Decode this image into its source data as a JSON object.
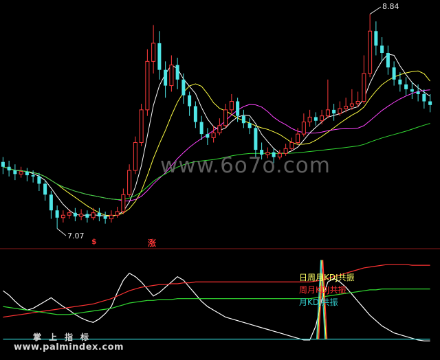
{
  "chart_data": [
    {
      "type": "candlestick",
      "panel": "price",
      "annotations": {
        "high": "8.84",
        "low": "7.07",
        "signal_1": "$",
        "signal_2": "涨"
      },
      "colors": {
        "up": "#ff3b3b",
        "down": "#4fe6e6",
        "ma5": "#ffffff",
        "ma10": "#ffff44",
        "ma20": "#ff44ff",
        "ma60": "#33dd33"
      },
      "candles": [
        [
          7.62,
          7.58,
          7.66,
          7.52
        ],
        [
          7.58,
          7.55,
          7.63,
          7.5
        ],
        [
          7.55,
          7.52,
          7.6,
          7.47
        ],
        [
          7.52,
          7.54,
          7.58,
          7.49
        ],
        [
          7.54,
          7.51,
          7.57,
          7.46
        ],
        [
          7.51,
          7.5,
          7.55,
          7.45
        ],
        [
          7.5,
          7.44,
          7.53,
          7.38
        ],
        [
          7.44,
          7.35,
          7.47,
          7.3
        ],
        [
          7.35,
          7.22,
          7.38,
          7.15
        ],
        [
          7.22,
          7.16,
          7.26,
          7.07
        ],
        [
          7.16,
          7.18,
          7.22,
          7.12
        ],
        [
          7.18,
          7.2,
          7.23,
          7.15
        ],
        [
          7.2,
          7.17,
          7.24,
          7.13
        ],
        [
          7.17,
          7.19,
          7.23,
          7.14
        ],
        [
          7.19,
          7.16,
          7.22,
          7.12
        ],
        [
          7.16,
          7.2,
          7.24,
          7.14
        ],
        [
          7.2,
          7.17,
          7.24,
          7.13
        ],
        [
          7.17,
          7.15,
          7.21,
          7.11
        ],
        [
          7.15,
          7.18,
          7.22,
          7.12
        ],
        [
          7.18,
          7.21,
          7.25,
          7.16
        ],
        [
          7.21,
          7.35,
          7.4,
          7.19
        ],
        [
          7.35,
          7.55,
          7.6,
          7.33
        ],
        [
          7.55,
          7.78,
          7.83,
          7.52
        ],
        [
          7.78,
          8.05,
          8.1,
          7.75
        ],
        [
          8.05,
          8.45,
          8.55,
          8.0
        ],
        [
          8.45,
          8.6,
          8.75,
          8.35
        ],
        [
          8.6,
          8.38,
          8.7,
          8.3
        ],
        [
          8.38,
          8.25,
          8.45,
          8.15
        ],
        [
          8.25,
          8.42,
          8.5,
          8.2
        ],
        [
          8.42,
          8.3,
          8.48,
          8.22
        ],
        [
          8.3,
          8.17,
          8.35,
          8.1
        ],
        [
          8.17,
          8.08,
          8.2,
          8.0
        ],
        [
          8.08,
          7.95,
          8.12,
          7.9
        ],
        [
          7.95,
          7.85,
          8.0,
          7.8
        ],
        [
          7.85,
          7.82,
          7.9,
          7.76
        ],
        [
          7.82,
          7.86,
          7.92,
          7.78
        ],
        [
          7.86,
          7.92,
          7.98,
          7.84
        ],
        [
          7.92,
          8.05,
          8.1,
          7.9
        ],
        [
          8.05,
          8.12,
          8.18,
          8.02
        ],
        [
          8.12,
          8.0,
          8.15,
          7.95
        ],
        [
          8.0,
          7.94,
          8.05,
          7.9
        ],
        [
          7.94,
          7.9,
          7.98,
          7.85
        ],
        [
          7.9,
          7.72,
          7.92,
          7.66
        ],
        [
          7.72,
          7.68,
          7.78,
          7.64
        ],
        [
          7.68,
          7.7,
          7.74,
          7.65
        ],
        [
          7.7,
          7.66,
          7.73,
          7.61
        ],
        [
          7.66,
          7.69,
          7.72,
          7.64
        ],
        [
          7.69,
          7.73,
          7.77,
          7.67
        ],
        [
          7.73,
          7.78,
          7.82,
          7.71
        ],
        [
          7.78,
          7.85,
          7.9,
          7.76
        ],
        [
          7.85,
          7.95,
          8.02,
          7.83
        ],
        [
          7.95,
          7.99,
          8.05,
          7.91
        ],
        [
          7.99,
          7.96,
          8.03,
          7.92
        ],
        [
          7.96,
          8.0,
          8.05,
          7.93
        ],
        [
          8.0,
          8.05,
          8.3,
          7.98
        ],
        [
          8.05,
          8.02,
          8.1,
          7.96
        ],
        [
          8.02,
          8.06,
          8.12,
          8.0
        ],
        [
          8.06,
          8.08,
          8.15,
          8.03
        ],
        [
          8.08,
          8.1,
          8.22,
          8.05
        ],
        [
          8.1,
          8.12,
          8.2,
          8.07
        ],
        [
          8.12,
          8.35,
          8.5,
          8.1
        ],
        [
          8.35,
          8.7,
          8.84,
          8.32
        ],
        [
          8.7,
          8.58,
          8.78,
          8.5
        ],
        [
          8.58,
          8.52,
          8.65,
          8.45
        ],
        [
          8.52,
          8.4,
          8.58,
          8.34
        ],
        [
          8.4,
          8.3,
          8.45,
          8.25
        ],
        [
          8.3,
          8.26,
          8.36,
          8.2
        ],
        [
          8.26,
          8.22,
          8.32,
          8.17
        ],
        [
          8.22,
          8.2,
          8.28,
          8.14
        ],
        [
          8.2,
          8.18,
          8.26,
          8.12
        ],
        [
          8.18,
          8.12,
          8.22,
          8.06
        ],
        [
          8.12,
          8.09,
          8.18,
          8.03
        ]
      ]
    },
    {
      "type": "line",
      "panel": "indicator",
      "series": [
        {
          "color": "#ffffff",
          "values": [
            60,
            55,
            48,
            42,
            38,
            40,
            44,
            48,
            52,
            47,
            42,
            38,
            33,
            29,
            26,
            24,
            28,
            34,
            42,
            58,
            72,
            80,
            76,
            70,
            62,
            54,
            58,
            64,
            70,
            76,
            72,
            64,
            56,
            48,
            42,
            38,
            34,
            30,
            28,
            26,
            24,
            22,
            20,
            18,
            16,
            14,
            12,
            10,
            8,
            6,
            4,
            4,
            20,
            50,
            70,
            74,
            70,
            64,
            56,
            48,
            40,
            32,
            26,
            20,
            16,
            12,
            10,
            8,
            6,
            4,
            3,
            3
          ]
        },
        {
          "color": "#ff3333",
          "values": [
            30,
            31,
            32,
            33,
            34,
            35,
            36,
            37,
            38,
            39,
            40,
            41,
            42,
            43,
            44,
            45,
            47,
            49,
            51,
            54,
            57,
            60,
            62,
            64,
            65,
            66,
            67,
            67,
            68,
            68,
            69,
            69,
            70,
            70,
            70,
            70,
            70,
            70,
            70,
            70,
            70,
            70,
            70,
            70,
            70,
            70,
            70,
            70,
            70,
            70,
            70,
            70,
            71,
            72,
            74,
            76,
            78,
            80,
            82,
            84,
            86,
            87,
            88,
            89,
            90,
            90,
            90,
            90,
            89,
            89,
            89,
            89
          ]
        },
        {
          "color": "#33dd33",
          "values": [
            42,
            41,
            40,
            39,
            38,
            37,
            36,
            35,
            34,
            33,
            33,
            33,
            34,
            35,
            36,
            37,
            38,
            39,
            40,
            42,
            44,
            46,
            47,
            48,
            49,
            49,
            50,
            50,
            50,
            51,
            51,
            51,
            51,
            51,
            51,
            51,
            51,
            51,
            51,
            51,
            51,
            51,
            51,
            51,
            51,
            51,
            51,
            51,
            51,
            51,
            51,
            51,
            52,
            53,
            54,
            55,
            56,
            57,
            58,
            59,
            60,
            61,
            61,
            62,
            62,
            62,
            62,
            62,
            62,
            62,
            62,
            62
          ]
        },
        {
          "color": "#33cccc",
          "values": [
            5,
            5,
            5,
            5,
            5,
            5,
            5,
            5,
            5,
            5,
            5,
            5,
            5,
            5,
            5,
            5,
            5,
            5,
            5,
            5,
            5,
            5,
            5,
            5,
            5,
            5,
            5,
            5,
            5,
            5,
            5,
            5,
            5,
            5,
            5,
            5,
            5,
            5,
            5,
            5,
            5,
            5,
            5,
            5,
            5,
            5,
            5,
            5,
            5,
            5,
            5,
            5,
            5,
            5,
            5,
            5,
            5,
            5,
            5,
            5,
            5,
            5,
            5,
            5,
            5,
            5,
            5,
            5,
            5,
            5,
            5,
            5
          ]
        }
      ],
      "annotations": {
        "resonance_day": "日周月KDJ共振",
        "resonance_week": "周月KDJ共振",
        "resonance_month": "月KDJ共振"
      }
    }
  ],
  "watermarks": {
    "site": "www.6o7o.com",
    "title": "掌上指标",
    "url": "www.palmindex.com"
  }
}
